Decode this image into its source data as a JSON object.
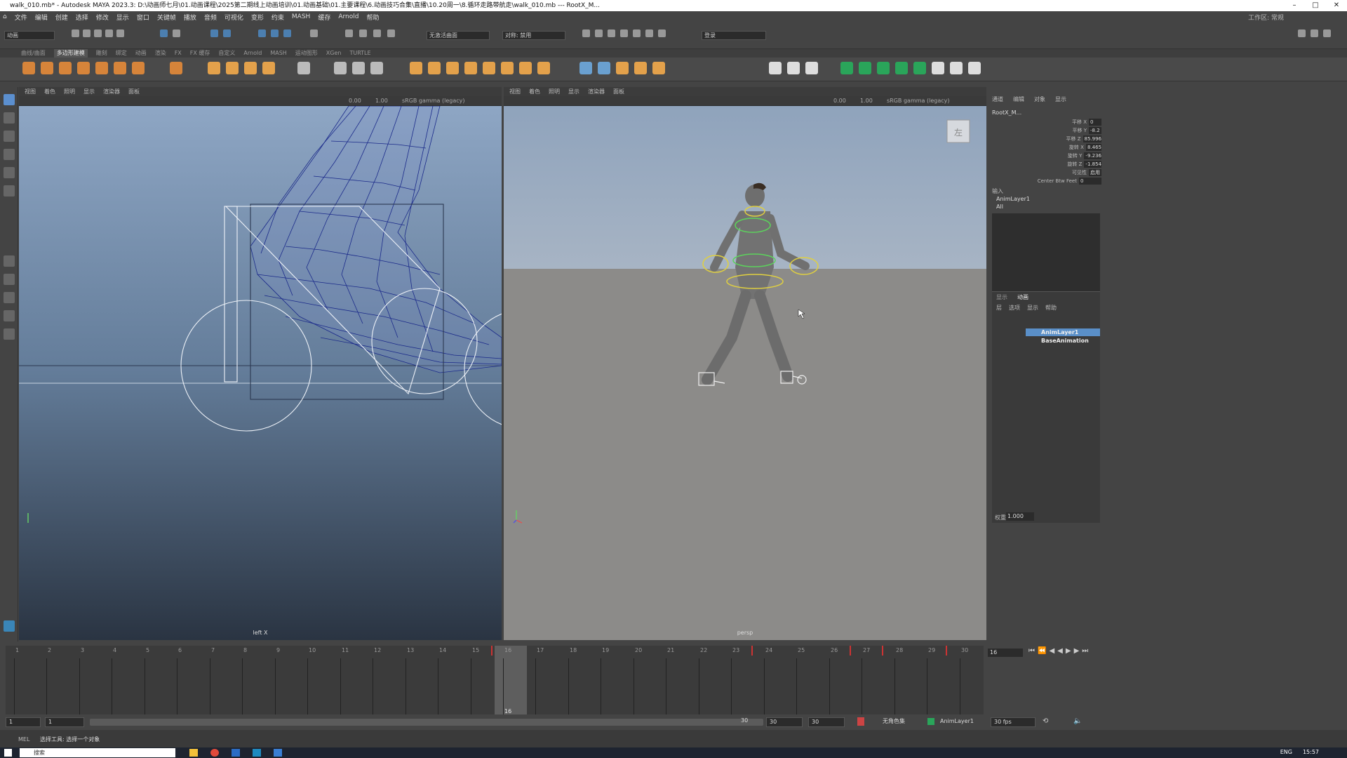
{
  "window": {
    "title": "walk_010.mb* - Autodesk MAYA 2023.3: D:\\动画师七月\\01.动画课程\\2025第二期线上动画培训\\01.动画基础\\01.主要课程\\6.动画技巧合集\\直播\\10.20周一\\8.循环走路带航走\\walk_010.mb   ---   RootX_M..."
  },
  "menus": [
    "文件",
    "编辑",
    "创建",
    "选择",
    "修改",
    "显示",
    "窗口",
    "关键帧",
    "播放",
    "音频",
    "可视化",
    "变形",
    "约束",
    "MASH",
    "缓存",
    "Arnold",
    "帮助"
  ],
  "workspace_label": "工作区: 常规",
  "status": {
    "mode_dropdown": "动画",
    "lighting_dropdown": "无激活曲面",
    "symmetry_dropdown": "对称: 禁用",
    "login": "登录"
  },
  "shelf_tabs": [
    "曲线/曲面",
    "多边形建模",
    "雕刻",
    "绑定",
    "动画",
    "渲染",
    "FX",
    "FX 缓存",
    "自定义",
    "Arnold",
    "MASH",
    "运动图形",
    "XGen",
    "TURTLE"
  ],
  "active_shelf_tab": "多边形建模",
  "viewport_menu": [
    "视图",
    "着色",
    "照明",
    "显示",
    "渲染器",
    "面板"
  ],
  "viewport_left": {
    "exposure": "0.00",
    "gamma": "1.00",
    "colorspace": "sRGB gamma (legacy)",
    "camera_label": "left X"
  },
  "viewport_right": {
    "exposure": "0.00",
    "gamma": "1.00",
    "colorspace": "sRGB gamma (legacy)",
    "camera_label": "persp",
    "viewcube_label": "左"
  },
  "channel_box": {
    "tabs": [
      "通道",
      "编辑",
      "对象",
      "显示"
    ],
    "object": "RootX_M...",
    "channels": [
      {
        "name": "平移 X",
        "value": "0"
      },
      {
        "name": "平移 Y",
        "value": "-8.2"
      },
      {
        "name": "平移 Z",
        "value": "85.996"
      },
      {
        "name": "旋转 X",
        "value": "8.465"
      },
      {
        "name": "旋转 Y",
        "value": "-9.236"
      },
      {
        "name": "旋转 Z",
        "value": "-1.854"
      },
      {
        "name": "可见性",
        "value": "启用"
      },
      {
        "name": "Center Btw Feet",
        "value": "0"
      }
    ],
    "inputs_label": "输入",
    "inputs": [
      "AnimLayer1",
      "All"
    ]
  },
  "layers": {
    "tabs": [
      "显示",
      "动画"
    ],
    "menu": [
      "层",
      "选项",
      "显示",
      "帮助"
    ],
    "rows": [
      {
        "name": "AnimLayer1",
        "selected": true
      },
      {
        "name": "BaseAnimation",
        "selected": false
      }
    ],
    "weight_label": "权重",
    "weight": "1.000"
  },
  "timeline": {
    "ticks": [
      "1",
      "2",
      "3",
      "4",
      "5",
      "6",
      "7",
      "8",
      "9",
      "10",
      "11",
      "12",
      "13",
      "14",
      "15",
      "16",
      "17",
      "18",
      "19",
      "20",
      "21",
      "22",
      "23",
      "24",
      "25",
      "26",
      "27",
      "28",
      "29",
      "30"
    ],
    "current_frame": "16",
    "current_frame_field": "16"
  },
  "range": {
    "start": "1",
    "inner_start": "1",
    "inner_end": "30",
    "end": "30",
    "end2": "30",
    "anim_layer": "AnimLayer1",
    "character": "无角色集",
    "fps": "30 fps"
  },
  "command": {
    "help_text": "选择工具: 选择一个对象",
    "mel_label": "MEL"
  },
  "taskbar": {
    "search_placeholder": "搜索",
    "time": "15:57",
    "lang": "ENG"
  },
  "colors": {
    "selected_layer": "#5a8fc8",
    "key_red": "#c33333",
    "wire_blue": "#1b2a8a"
  }
}
